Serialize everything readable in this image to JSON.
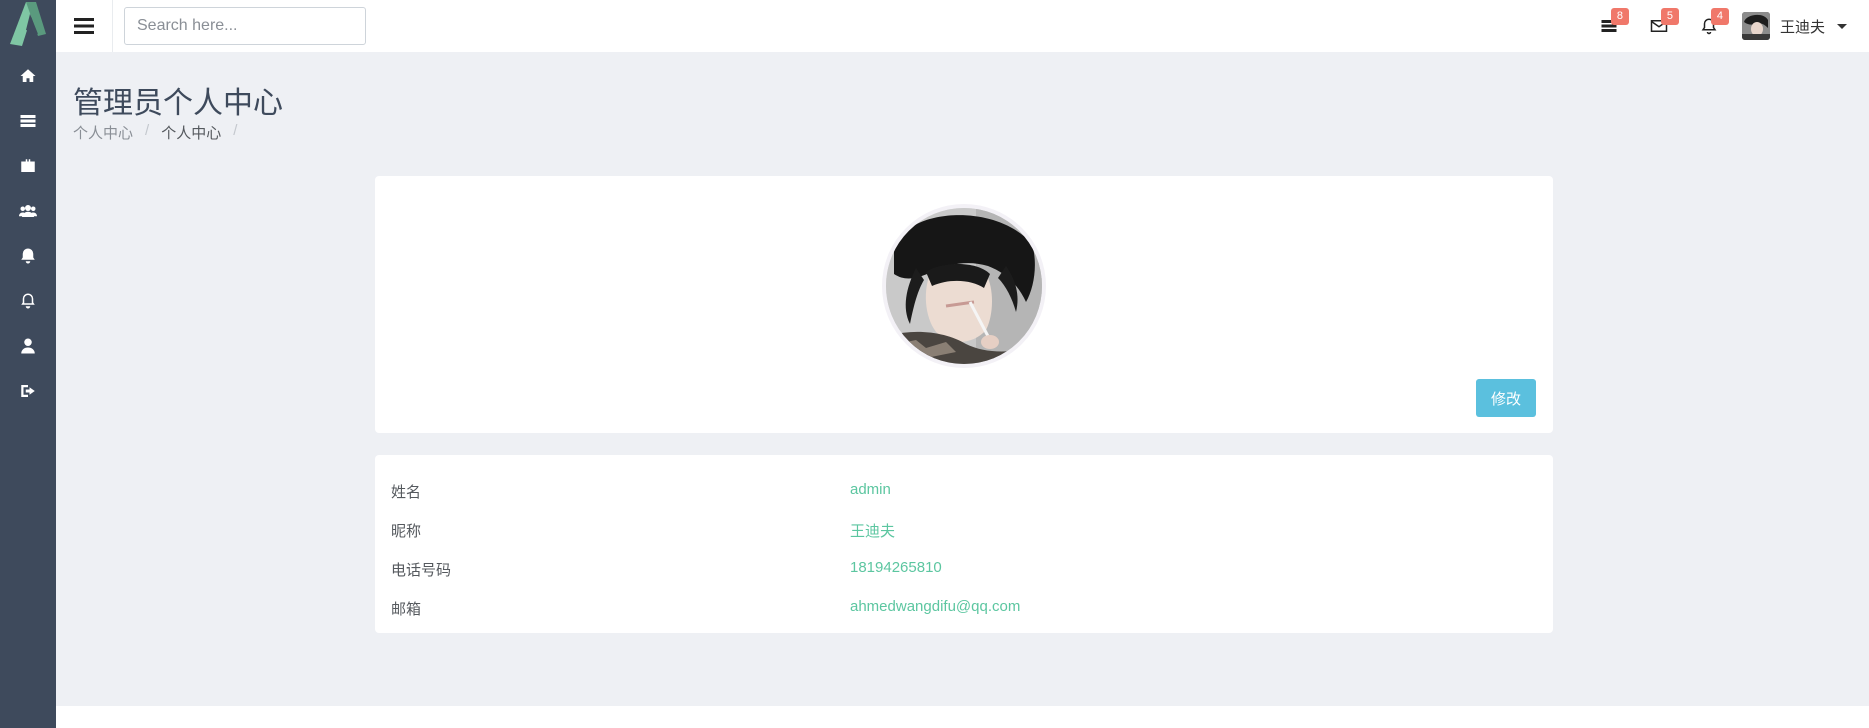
{
  "sidebar": {
    "items": [
      {
        "icon": "home-icon"
      },
      {
        "icon": "server-icon"
      },
      {
        "icon": "briefcase-icon"
      },
      {
        "icon": "users-icon"
      },
      {
        "icon": "bell-filled-icon"
      },
      {
        "icon": "bell-outline-icon"
      },
      {
        "icon": "user-icon"
      },
      {
        "icon": "sign-out-icon"
      }
    ]
  },
  "header": {
    "search_placeholder": "Search here...",
    "notifications": [
      {
        "icon": "tasks-icon",
        "count": "8"
      },
      {
        "icon": "envelope-icon",
        "count": "5"
      },
      {
        "icon": "bell-icon",
        "count": "4"
      }
    ],
    "user_name": "王迪夫"
  },
  "page": {
    "title": "管理员个人中心",
    "breadcrumb": [
      "个人中心",
      "个人中心"
    ]
  },
  "profile": {
    "edit_label": "修改",
    "fields": [
      {
        "label": "姓名",
        "value": "admin"
      },
      {
        "label": "昵称",
        "value": "王迪夫"
      },
      {
        "label": "电话号码",
        "value": "18194265810"
      },
      {
        "label": "邮箱",
        "value": "ahmedwangdifu@qq.com"
      }
    ]
  },
  "colors": {
    "sidebar_bg": "#3e4a5c",
    "badge": "#f0786a",
    "edit_button": "#5bc0de",
    "value_text": "#5cc6a0"
  }
}
